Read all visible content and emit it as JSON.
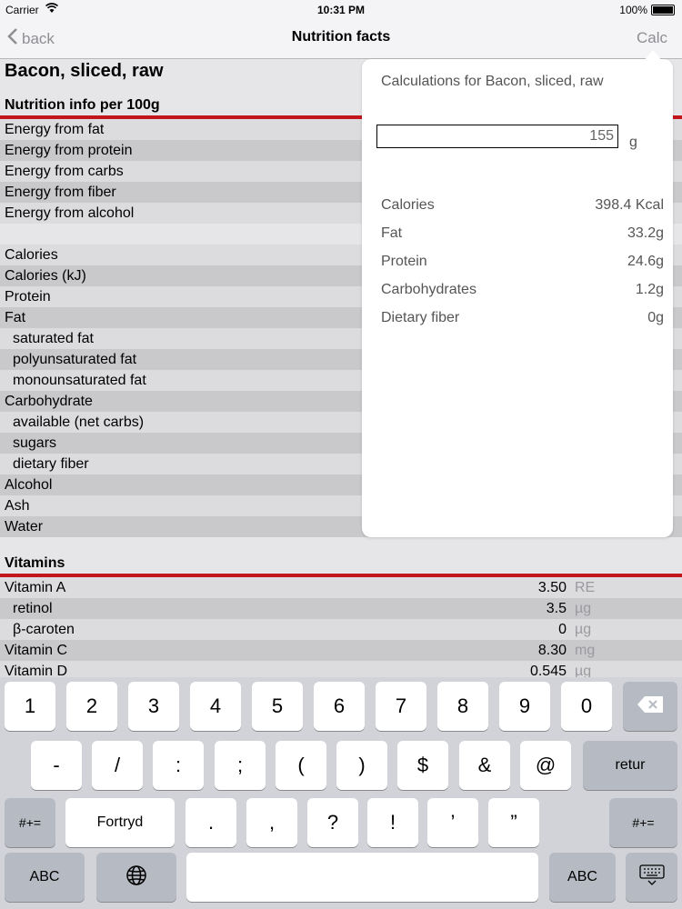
{
  "status": {
    "carrier": "Carrier",
    "time": "10:31 PM",
    "battery": "100%"
  },
  "nav": {
    "back": "back",
    "title": "Nutrition facts",
    "calc": "Calc"
  },
  "food_title": "Bacon, sliced, raw",
  "nutrition": {
    "header": "Nutrition info per 100g",
    "energy_rows": [
      "Energy from fat",
      "Energy from protein",
      "Energy from carbs",
      "Energy from fiber",
      "Energy from alcohol"
    ],
    "nutrient_rows": [
      "Calories",
      "Calories (kJ)",
      "Protein",
      "Fat",
      "saturated fat",
      "polyunsaturated fat",
      "monounsaturated fat",
      "Carbohydrate",
      "available (net carbs)",
      "sugars",
      "dietary fiber",
      "Alcohol",
      "Ash",
      "Water"
    ]
  },
  "vitamins": {
    "header": "Vitamins",
    "rows": [
      {
        "name": "Vitamin A",
        "value": "3.50",
        "unit": "RE"
      },
      {
        "name": "retinol",
        "value": "3.5",
        "unit": "µg"
      },
      {
        "name": "β-caroten",
        "value": "0",
        "unit": "µg"
      },
      {
        "name": "Vitamin C",
        "value": "8.30",
        "unit": "mg"
      },
      {
        "name": "Vitamin D",
        "value": "0.545",
        "unit": "µg"
      }
    ]
  },
  "popover": {
    "title": "Calculations for Bacon, sliced, raw",
    "amount": "155",
    "amount_unit": "g",
    "rows": [
      {
        "label": "Calories",
        "value": "398.4 Kcal"
      },
      {
        "label": "Fat",
        "value": "33.2g"
      },
      {
        "label": "Protein",
        "value": "24.6g"
      },
      {
        "label": "Carbohydrates",
        "value": "1.2g"
      },
      {
        "label": "Dietary fiber",
        "value": "0g"
      }
    ]
  },
  "keyboard": {
    "row1": [
      "1",
      "2",
      "3",
      "4",
      "5",
      "6",
      "7",
      "8",
      "9",
      "0"
    ],
    "row2": [
      "-",
      "/",
      ":",
      ";",
      "(",
      ")",
      "$",
      "&",
      "@"
    ],
    "return": "retur",
    "symbols": "#+=",
    "undo": "Fortryd",
    "row3": [
      ".",
      ",",
      "?",
      "!",
      "’",
      "”"
    ],
    "abc": "ABC"
  }
}
